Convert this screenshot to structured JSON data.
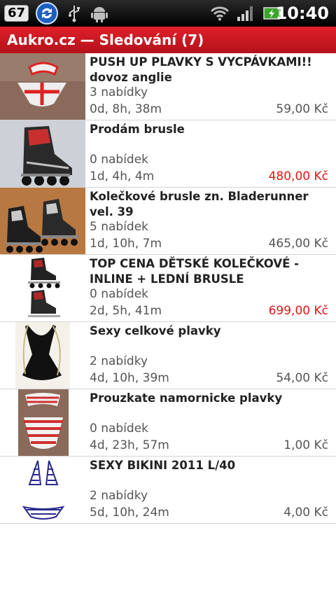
{
  "status_bar": {
    "badge": "67",
    "time": "10:40",
    "icons": [
      "sync-icon",
      "usb-icon",
      "android-debug-icon",
      "wifi-icon",
      "signal-icon",
      "battery-icon"
    ]
  },
  "header": {
    "title": "Aukro.cz — Sledování (7)"
  },
  "colors": {
    "accent": "#d0151f",
    "price_highlight": "#e01515"
  },
  "items": [
    {
      "title": "PUSH UP PLAVKY  S VYCPÁVKAMI!! dovoz anglie",
      "bids": "3 nabídky",
      "time_left": "0d, 8h, 38m",
      "price": "59,00 Kč",
      "price_highlight": false
    },
    {
      "title": "Prodám  brusle",
      "bids": "0 nabídek",
      "time_left": "1d, 4h, 4m",
      "price": "480,00 Kč",
      "price_highlight": true
    },
    {
      "title": "Kolečkové brusle zn. Bladerunner vel. 39",
      "bids": "5 nabídek",
      "time_left": "1d, 10h, 7m",
      "price": "465,00 Kč",
      "price_highlight": false
    },
    {
      "title": "TOP CENA DĚTSKÉ KOLEČKOVÉ - INLINE + LEDNÍ BRUSLE",
      "bids": "0 nabídek",
      "time_left": "2d, 5h, 41m",
      "price": "699,00 Kč",
      "price_highlight": true
    },
    {
      "title": "Sexy celkové plavky",
      "bids": "2 nabídky",
      "time_left": "4d, 10h, 39m",
      "price": "54,00 Kč",
      "price_highlight": false
    },
    {
      "title": "Prouzkate namornicke plavky",
      "bids": "0 nabídek",
      "time_left": "4d, 23h, 57m",
      "price": "1,00 Kč",
      "price_highlight": false
    },
    {
      "title": "SEXY BIKINI 2011         L/40",
      "bids": "2 nabídky",
      "time_left": "5d, 10h, 24m",
      "price": "4,00 Kč",
      "price_highlight": false
    }
  ]
}
